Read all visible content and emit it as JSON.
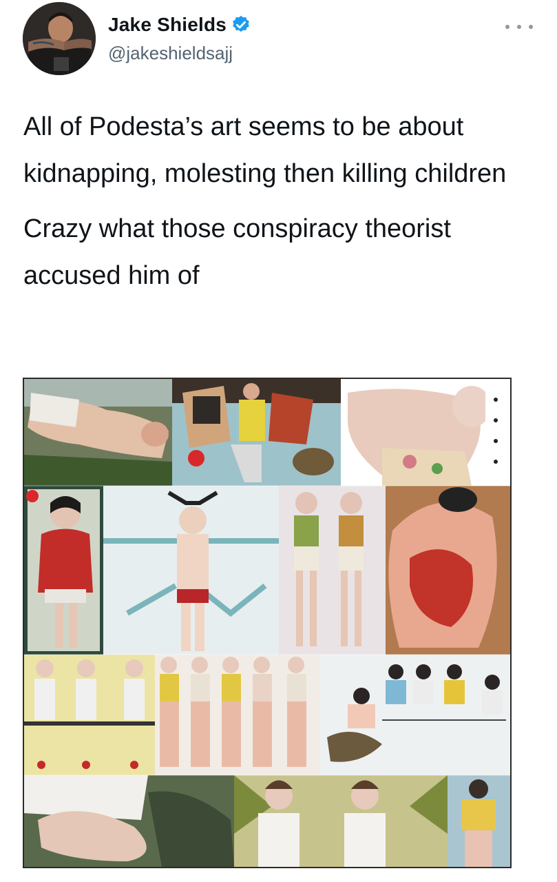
{
  "author": {
    "name": "Jake Shields",
    "handle": "@jakeshieldsajj",
    "verified": true,
    "avatar_icon": "profile-avatar"
  },
  "menu": {
    "icon": "more-horizontal-icon"
  },
  "tweet": {
    "paragraphs": [
      "All of Podesta’s art seems to be about kidnapping, molesting then killing children",
      "Crazy what those conspiracy theorist accused him of"
    ]
  },
  "media": {
    "type": "image-collage",
    "description_icon": "artwork-collage-image"
  },
  "colors": {
    "text": "#0f1419",
    "secondary": "#536471",
    "verified": "#1d9bf0"
  }
}
